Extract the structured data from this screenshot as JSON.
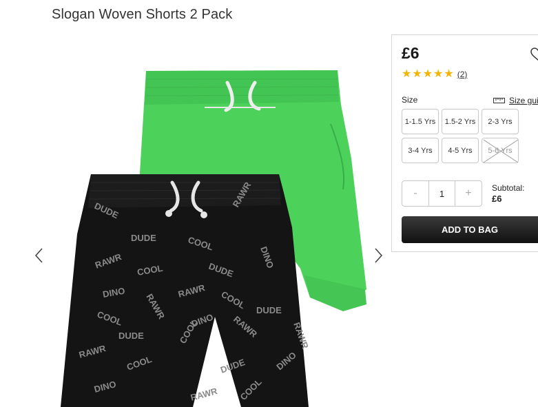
{
  "product": {
    "title": "Slogan Woven Shorts 2 Pack",
    "price": "£6",
    "rating": {
      "stars": 5,
      "review_count": "(2)"
    }
  },
  "size": {
    "label": "Size",
    "guide_label": "Size guide",
    "options": [
      {
        "label": "1-1.5 Yrs",
        "available": true
      },
      {
        "label": "1.5-2 Yrs",
        "available": true
      },
      {
        "label": "2-3 Yrs",
        "available": true
      },
      {
        "label": "3-4 Yrs",
        "available": true
      },
      {
        "label": "4-5 Yrs",
        "available": true
      },
      {
        "label": "5-6 Yrs",
        "available": false
      }
    ]
  },
  "quantity": {
    "minus": "-",
    "value": "1",
    "plus": "+"
  },
  "subtotal": {
    "label": "Subtotal:",
    "value": "£6"
  },
  "add_to_bag": "ADD TO BAG",
  "image": {
    "print_words": [
      "DINO",
      "RAWR",
      "COOL",
      "DUDE"
    ],
    "colors": {
      "green_shorts": "#4fd45f",
      "black_shorts": "#141414",
      "print": "#8c8c8c"
    }
  },
  "icons": {
    "prev": "chevron-left-icon",
    "next": "chevron-right-icon",
    "wishlist": "heart-icon",
    "size_guide": "ruler-icon"
  }
}
